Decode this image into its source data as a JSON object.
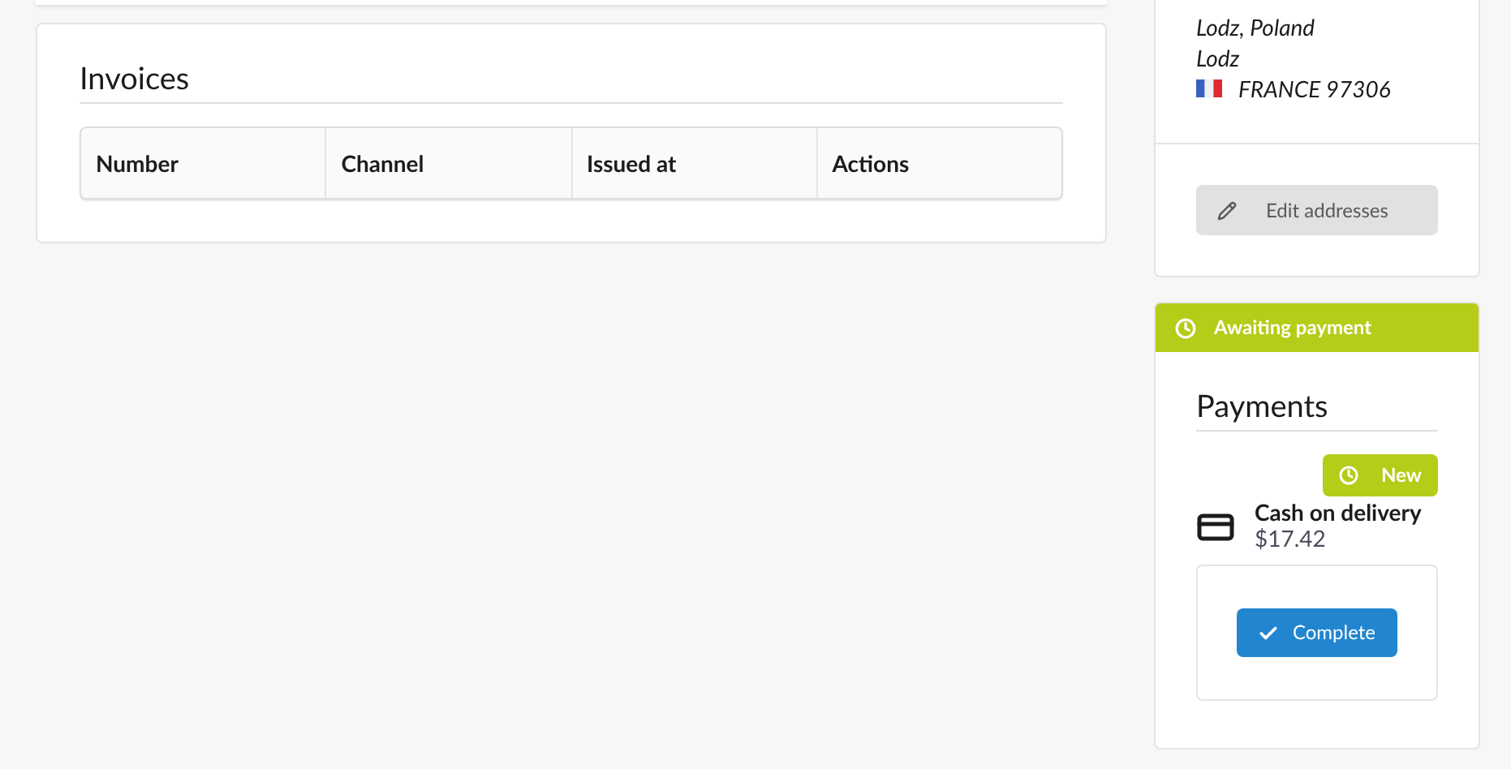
{
  "invoices": {
    "title": "Invoices",
    "columns": [
      "Number",
      "Channel",
      "Issued at",
      "Actions"
    ]
  },
  "address": {
    "lines": [
      "Lodz, Poland",
      "Lodz"
    ],
    "country": "FRANCE 97306",
    "edit_button": "Edit addresses"
  },
  "payment_state": "Awaiting payment",
  "payments": {
    "title": "Payments",
    "items": [
      {
        "state": "New",
        "method": "Cash on delivery",
        "amount": "$17.42",
        "action": "Complete"
      }
    ]
  }
}
